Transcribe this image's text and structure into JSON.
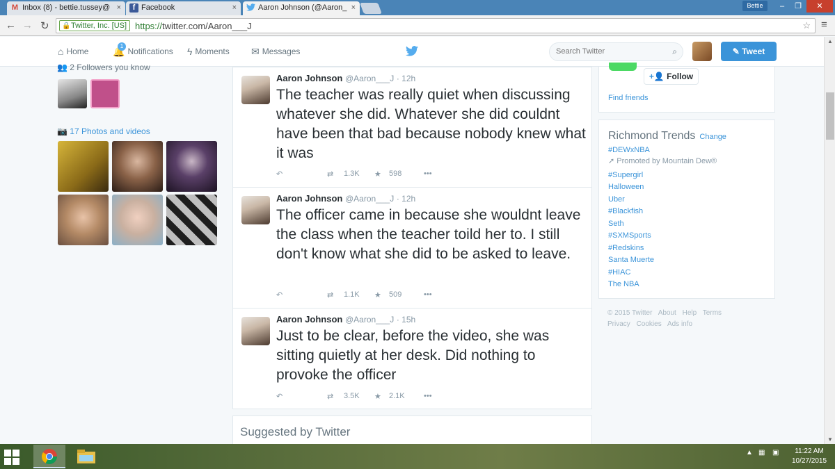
{
  "browser": {
    "tabs": [
      {
        "label": "Inbox (8) - bettie.tussey@",
        "icon": "gmail-icon",
        "icon_glyph": "M",
        "color": "#d44638"
      },
      {
        "label": "Facebook",
        "icon": "facebook-icon",
        "icon_glyph": "f",
        "color": "#3b5998"
      },
      {
        "label": "Aaron Johnson (@Aaron_",
        "icon": "twitter-icon",
        "icon_glyph": "🐦",
        "color": "#55acee"
      }
    ],
    "tab_close": "×",
    "user": "Bettie",
    "ev_label": "Twitter, Inc. [US]",
    "url_scheme": "https://",
    "url_rest": "twitter.com/Aaron___J"
  },
  "twitter_nav": {
    "home": "Home",
    "notifications": "Notifications",
    "notifications_count": "1",
    "moments": "Moments",
    "messages": "Messages",
    "search_placeholder": "Search Twitter",
    "tweet_button": "Tweet"
  },
  "left": {
    "followers_you_know": "2 Followers you know",
    "photos_videos": "17 Photos and videos"
  },
  "tweets": [
    {
      "name": "Aaron Johnson",
      "handle": "@Aaron___J",
      "time": "· 12h",
      "text": "The teacher was really quiet when discussing whatever she did. Whatever she did couldnt have been that bad because nobody knew what it was",
      "retweets": "1.3K",
      "likes": "598"
    },
    {
      "name": "Aaron Johnson",
      "handle": "@Aaron___J",
      "time": "· 12h",
      "text": "The officer came in because she wouldnt leave the class when the teacher toild her to. I still don't know what she did to be asked to leave.",
      "retweets": "1.1K",
      "likes": "509"
    },
    {
      "name": "Aaron Johnson",
      "handle": "@Aaron___J",
      "time": "· 15h",
      "text": "Just to be clear, before the video, she was sitting quietly at her desk. Did nothing to provoke the officer",
      "retweets": "3.5K",
      "likes": "2.1K"
    }
  ],
  "suggested": "Suggested by Twitter",
  "right": {
    "follow": "Follow",
    "find_friends": "Find friends",
    "trends_title": "Richmond Trends",
    "trends_change": "Change",
    "trends": [
      "#DEWxNBA",
      "#Supergirl",
      "Halloween",
      "Uber",
      "#Blackfish",
      "Seth",
      "#SXMSports",
      "#Redskins",
      "Santa Muerte",
      "#HIAC",
      "The NBA"
    ],
    "promoted": "Promoted by Mountain Dew®",
    "footer1": [
      "© 2015 Twitter",
      "About",
      "Help",
      "Terms"
    ],
    "footer2": [
      "Privacy",
      "Cookies",
      "Ads info"
    ]
  },
  "taskbar": {
    "time": "11:22 AM",
    "date": "10/27/2015"
  }
}
